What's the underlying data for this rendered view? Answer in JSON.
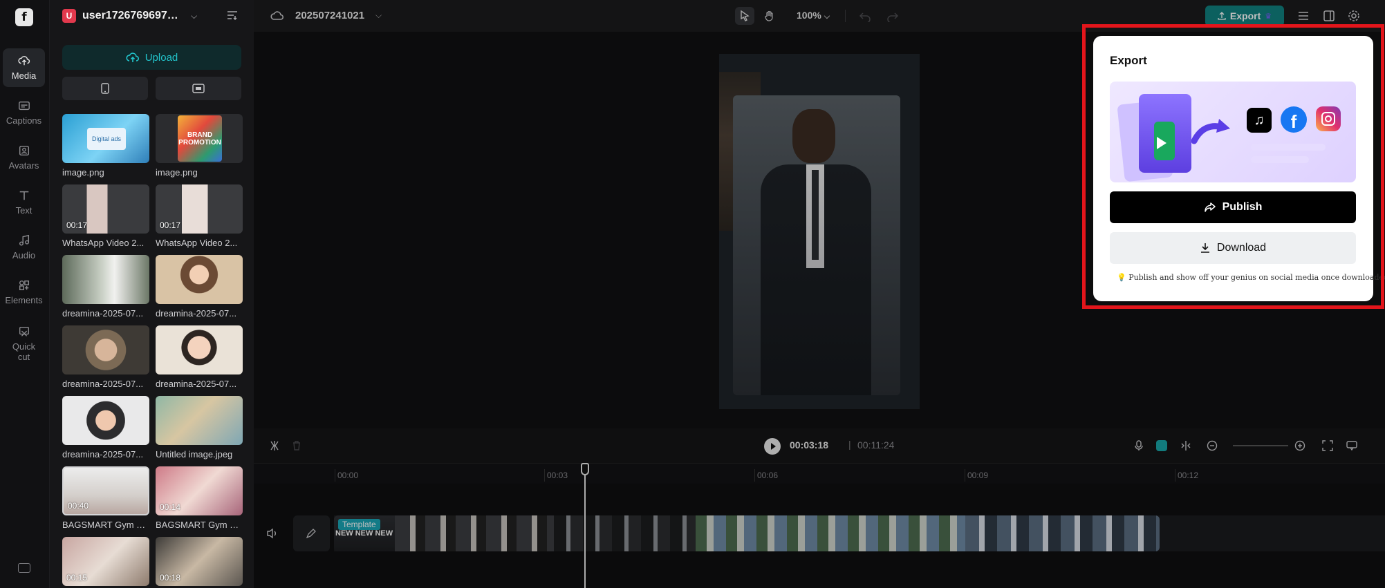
{
  "rail": {
    "logo": "f",
    "items": [
      {
        "label": "Media",
        "icon": "cloud-upload-icon"
      },
      {
        "label": "Captions",
        "icon": "captions-icon"
      },
      {
        "label": "Avatars",
        "icon": "avatar-icon"
      },
      {
        "label": "Text",
        "icon": "text-icon"
      },
      {
        "label": "Audio",
        "icon": "music-note-icon"
      },
      {
        "label": "Elements",
        "icon": "elements-icon"
      },
      {
        "label": "Quick cut",
        "icon": "quick-cut-icon"
      }
    ]
  },
  "panel": {
    "workspace_initial": "U",
    "workspace_name": "user172676969755...",
    "upload_label": "Upload",
    "items": [
      {
        "name": "image.png",
        "duration": ""
      },
      {
        "name": "image.png",
        "duration": ""
      },
      {
        "name": "WhatsApp Video 2...",
        "duration": "00:17"
      },
      {
        "name": "WhatsApp Video 2...",
        "duration": "00:17"
      },
      {
        "name": "dreamina-2025-07...",
        "duration": ""
      },
      {
        "name": "dreamina-2025-07...",
        "duration": ""
      },
      {
        "name": "dreamina-2025-07...",
        "duration": ""
      },
      {
        "name": "dreamina-2025-07...",
        "duration": ""
      },
      {
        "name": "dreamina-2025-07...",
        "duration": ""
      },
      {
        "name": "Untitled image.jpeg",
        "duration": ""
      },
      {
        "name": "BAGSMART Gym B...",
        "duration": "00:40"
      },
      {
        "name": "BAGSMART Gym B...",
        "duration": "00:14"
      },
      {
        "name": "",
        "duration": "00:15"
      },
      {
        "name": "",
        "duration": "00:18"
      }
    ],
    "thumb_text": {
      "digital": "Digital ads",
      "brand": "BRAND PROMOTION"
    }
  },
  "topbar": {
    "project_name": "202507241021",
    "zoom": "100%",
    "export_label": "Export"
  },
  "timeline": {
    "current_time": "00:03:18",
    "separator": "|",
    "total_time": "00:11:24",
    "ticks": [
      "00:00",
      "00:03",
      "00:06",
      "00:09",
      "00:12"
    ],
    "template_tag": "Template",
    "clip_text": "NEW NEW NEW"
  },
  "export_panel": {
    "title": "Export",
    "publish_label": "Publish",
    "download_label": "Download",
    "tip_emoji": "💡",
    "tip": "Publish and show off your genius on social media once downloaded."
  },
  "colors": {
    "accent": "#22c5cc",
    "export_button": "#10807f",
    "highlight": "#e3151b",
    "tiktok": "#000000",
    "facebook": "#1877f2",
    "instagram": "#e1306c"
  }
}
